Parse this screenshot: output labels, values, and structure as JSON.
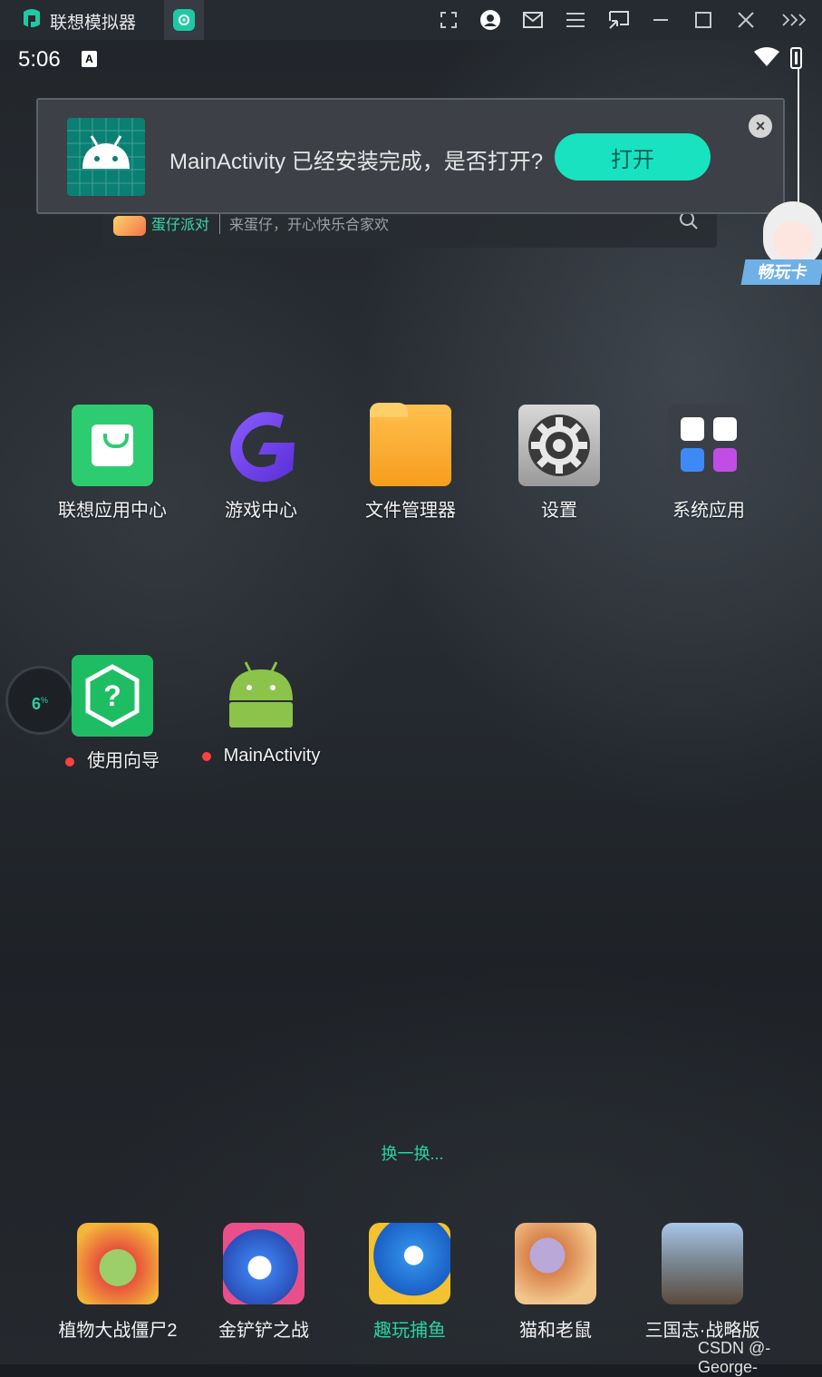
{
  "window": {
    "title": "联想模拟器"
  },
  "statusbar": {
    "time": "5:06",
    "ime_badge": "A"
  },
  "search": {
    "brand": "蛋仔派对",
    "placeholder": "来蛋仔，开心快乐合家欢"
  },
  "notification": {
    "message": "MainActivity 已经安装完成，是否打开?",
    "open_label": "打开"
  },
  "mascot": {
    "tag": "畅玩卡"
  },
  "apps": [
    {
      "label": "联想应用中心"
    },
    {
      "label": "游戏中心"
    },
    {
      "label": "文件管理器"
    },
    {
      "label": "设置"
    },
    {
      "label": "系统应用"
    },
    {
      "label": "使用向导"
    },
    {
      "label": "MainActivity"
    }
  ],
  "memory_widget": {
    "value": "6",
    "unit": "%"
  },
  "refresh_label": "换一换...",
  "dock": [
    {
      "label": "植物大战僵尸2"
    },
    {
      "label": "金铲铲之战"
    },
    {
      "label": "趣玩捕鱼",
      "color": "#27d3a0"
    },
    {
      "label": "猫和老鼠"
    },
    {
      "label": "三国志·战略版"
    }
  ],
  "watermark": "CSDN @-George-",
  "colors": {
    "accent": "#19e2c0",
    "titlebar": "#262a31",
    "badge_dot": "#ff4040"
  }
}
